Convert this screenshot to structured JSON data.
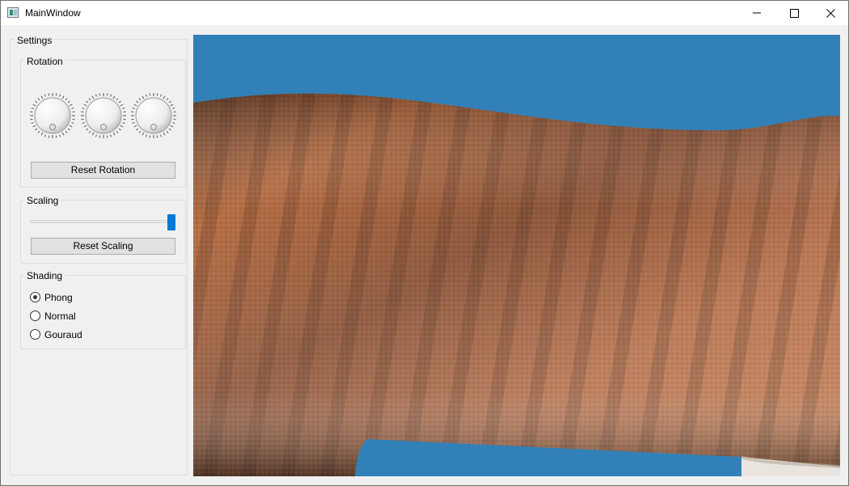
{
  "window": {
    "title": "MainWindow",
    "minimize_icon": "minimize-icon",
    "maximize_icon": "maximize-icon",
    "close_icon": "close-icon"
  },
  "settings": {
    "title": "Settings",
    "rotation": {
      "title": "Rotation",
      "dials": [
        "rotation-x-dial",
        "rotation-y-dial",
        "rotation-z-dial"
      ],
      "reset_label": "Reset Rotation"
    },
    "scaling": {
      "title": "Scaling",
      "slider_value": 1.0,
      "reset_label": "Reset Scaling"
    },
    "shading": {
      "title": "Shading",
      "options": [
        {
          "label": "Phong",
          "selected": true
        },
        {
          "label": "Normal",
          "selected": false
        },
        {
          "label": "Gouraud",
          "selected": false
        }
      ]
    }
  },
  "viewport": {
    "background_color": "#3181b8",
    "object": "cat-fur-texture-model"
  }
}
